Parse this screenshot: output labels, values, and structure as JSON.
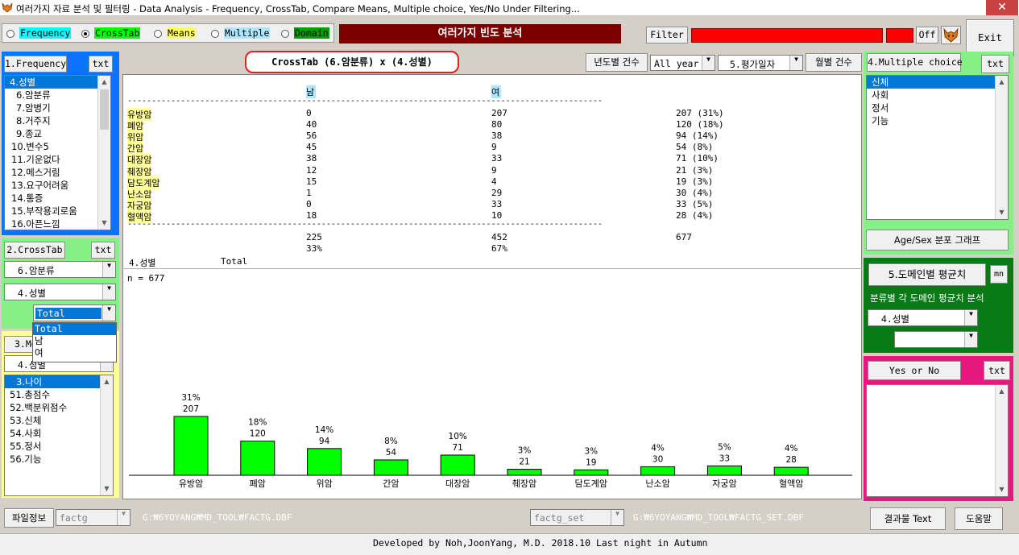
{
  "window": {
    "title": "여러가지 자료 분석 및 필터링 - Data Analysis - Frequency, CrossTab, Compare Means, Multiple choice, Yes/No Under Filtering...",
    "close": "✕"
  },
  "modes": [
    {
      "label": "Frequency",
      "selected": false
    },
    {
      "label": "CrossTab",
      "selected": true
    },
    {
      "label": "Means",
      "selected": false
    },
    {
      "label": "Multiple",
      "selected": false
    },
    {
      "label": "Domain",
      "selected": false
    }
  ],
  "banner": "여러가지 빈도 분석",
  "filter": {
    "button": "Filter",
    "off_button": "Off"
  },
  "exit_button": "Exit",
  "panel1": {
    "button": "1.Frequency",
    "txt": "txt",
    "items": [
      "4.성별",
      "6.암분류",
      "7.암병기",
      "8.거주지",
      "9.종교",
      "10.변수5",
      "11.기운없다",
      "12.메스거림",
      "13.요구어려움",
      "14.통증",
      "15.부작용괴로움",
      "16.아픈느낌"
    ]
  },
  "panel2": {
    "button": "2.CrossTab",
    "txt": "txt",
    "combo1": "6.암분류",
    "combo2": "4.성별",
    "combo3": "Total",
    "dropdown": [
      "Total",
      "남",
      "여"
    ]
  },
  "panel3": {
    "button": "3.Means",
    "combo": "4.성별",
    "items": [
      "3.나이",
      "51.총점수",
      "52.백분위점수",
      "53.신체",
      "54.사회",
      "55.정서",
      "56.기능"
    ]
  },
  "top": {
    "heading": "CrossTab (6.암분류) x (4.성별)",
    "year_label": "년도별 건수",
    "year_combo": "All year",
    "date_combo": "5.평가일자",
    "month_label": "월별 건수"
  },
  "crosstab": {
    "col_headers": [
      "남",
      "여"
    ],
    "rows": [
      {
        "label": "유방암",
        "m": "0",
        "f": "207",
        "total": "207 (31%)"
      },
      {
        "label": "폐암",
        "m": "40",
        "f": "80",
        "total": "120 (18%)"
      },
      {
        "label": "위암",
        "m": "56",
        "f": "38",
        "total": "94 (14%)"
      },
      {
        "label": "간암",
        "m": "45",
        "f": "9",
        "total": "54 (8%)"
      },
      {
        "label": "대장암",
        "m": "38",
        "f": "33",
        "total": "71 (10%)"
      },
      {
        "label": "췌장암",
        "m": "12",
        "f": "9",
        "total": "21 (3%)"
      },
      {
        "label": "담도계암",
        "m": "15",
        "f": "4",
        "total": "19 (3%)"
      },
      {
        "label": "난소암",
        "m": "1",
        "f": "29",
        "total": "30 (4%)"
      },
      {
        "label": "자궁암",
        "m": "0",
        "f": "33",
        "total": "33 (5%)"
      },
      {
        "label": "혈액암",
        "m": "18",
        "f": "10",
        "total": "28 (4%)"
      }
    ],
    "dash_line": "-------------------------------------------------------------------------------------------------------",
    "totals": {
      "m": "225",
      "f": "452",
      "all": "677",
      "m_pct": "33%",
      "f_pct": "67%"
    },
    "footer_var": "4.성별",
    "footer_total": "Total"
  },
  "chart_data": {
    "type": "bar",
    "title": "n = 677",
    "categories": [
      "유방암",
      "폐암",
      "위암",
      "간암",
      "대장암",
      "췌장암",
      "담도계암",
      "난소암",
      "자궁암",
      "혈액암"
    ],
    "values": [
      207,
      120,
      94,
      54,
      71,
      21,
      19,
      30,
      33,
      28
    ],
    "percents": [
      "31%",
      "18%",
      "14%",
      "8%",
      "10%",
      "3%",
      "3%",
      "4%",
      "5%",
      "4%"
    ],
    "ylim": [
      0,
      207
    ],
    "bar_color": "#00ff00"
  },
  "panel4": {
    "button": "4.Multiple choice",
    "txt": "txt",
    "items": [
      "신체",
      "사회",
      "정서",
      "기능"
    ],
    "graph_button": "Age/Sex 분포 그래프"
  },
  "panel5": {
    "button": "5.도메인별 평균치",
    "mn": "mn",
    "desc": "분류별 각 도메인 평균치 분석",
    "combo1": "4.성별",
    "combo2": ""
  },
  "panel6": {
    "button": "Yes or No",
    "txt": "txt"
  },
  "bottom": {
    "file_button": "파일정보",
    "combo1": "factg",
    "path1": "G:₩6YOYANG₩MD_TOOL₩FACTG.DBF",
    "combo2": "factg_set",
    "path2": "G:₩6YOYANG₩MD_TOOL₩FACTG_SET.DBF",
    "result_button": "결과물 Text",
    "help_button": "도움말"
  },
  "status": "Developed by Noh,JoonYang, M.D. 2018.10  Last night in Autumn",
  "colors": {
    "blue_panel": "#0a74ff",
    "green_panel": "#86f086",
    "yellow_panel": "#ffff99",
    "dark_green": "#0a7a16",
    "magenta": "#e6177d",
    "banner": "#7a0000",
    "filter_red": "#ff0000"
  }
}
